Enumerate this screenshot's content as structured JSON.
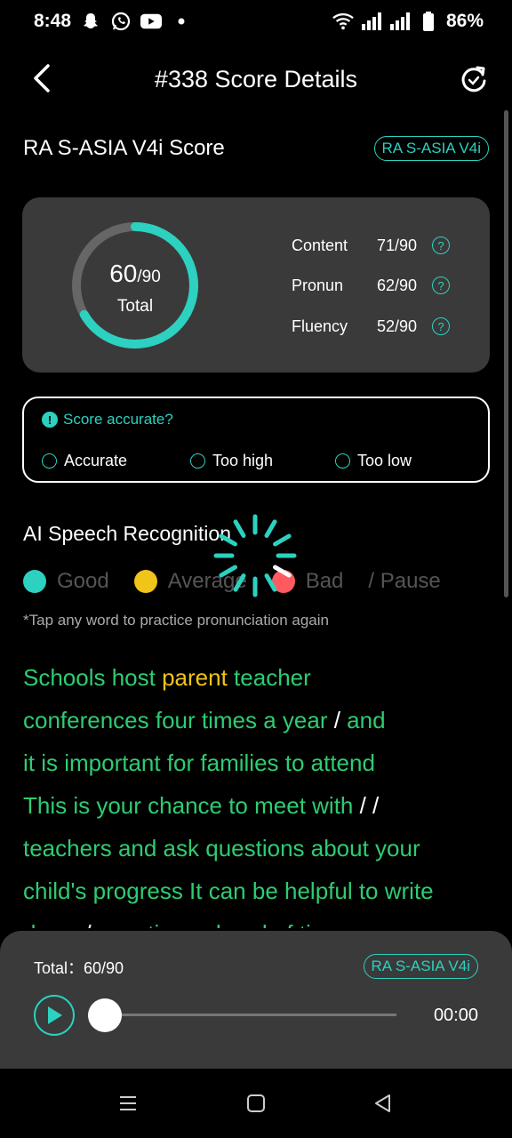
{
  "status_bar": {
    "time": "8:48",
    "battery": "86%",
    "left_icons": [
      "snapchat-icon",
      "whatsapp-icon",
      "youtube-icon",
      "dot-icon"
    ],
    "right_icons": [
      "wifi-icon",
      "signal-icon",
      "signal-icon",
      "battery-icon"
    ]
  },
  "header": {
    "title": "#338 Score Details",
    "back_icon": "chevron-left-icon",
    "refresh_icon": "refresh-icon"
  },
  "score": {
    "title": "RA S-ASIA V4i Score",
    "badge": "RA S-ASIA V4i",
    "total_value": "60",
    "total_max": "/90",
    "total_label": "Total",
    "total_fraction": 0.667,
    "metrics": [
      {
        "label": "Content",
        "value": "71/90"
      },
      {
        "label": "Pronun",
        "value": "62/90"
      },
      {
        "label": "Fluency",
        "value": "52/90"
      }
    ]
  },
  "accuracy": {
    "question": "Score accurate?",
    "options": [
      "Accurate",
      "Too high",
      "Too low"
    ]
  },
  "asr": {
    "title": "AI Speech Recognition",
    "legend": [
      {
        "label": "Good",
        "color": "#2cd1c0"
      },
      {
        "label": "Average",
        "color": "#f0c419"
      },
      {
        "label": "Bad",
        "color": "#ff5a5f"
      },
      {
        "label": "/ Pause",
        "color": ""
      }
    ],
    "hint": "*Tap any word to practice pronunciation again"
  },
  "passage": {
    "lines": [
      [
        {
          "t": "Schools host ",
          "c": "good"
        },
        {
          "t": "parent",
          "c": "avg"
        },
        {
          "t": " teacher",
          "c": "good"
        }
      ],
      [
        {
          "t": "conferences four times a year ",
          "c": "good"
        },
        {
          "t": "/",
          "c": "pause"
        },
        {
          "t": " and",
          "c": "good"
        }
      ],
      [
        {
          "t": "it is important for families to attend",
          "c": "good"
        }
      ],
      [
        {
          "t": "This is your chance to meet with ",
          "c": "good"
        },
        {
          "t": "/ /",
          "c": "pause"
        }
      ],
      [
        {
          "t": "teachers and ask questions about your",
          "c": "good"
        }
      ],
      [
        {
          "t": "child's progress It can be helpful to write",
          "c": "good"
        }
      ],
      [
        {
          "t": "down ",
          "c": "good"
        },
        {
          "t": "/",
          "c": "pause"
        },
        {
          "t": " questions ahead of time",
          "c": "good"
        }
      ]
    ]
  },
  "player": {
    "total_label": "Total：60/90",
    "badge": "RA S-ASIA V4i",
    "time": "00:00",
    "progress": 0
  },
  "colors": {
    "accent": "#2cd1c0",
    "good": "#2ecc71",
    "average": "#f0c419",
    "bad": "#ff5a5f",
    "card": "#3a3a3a"
  }
}
